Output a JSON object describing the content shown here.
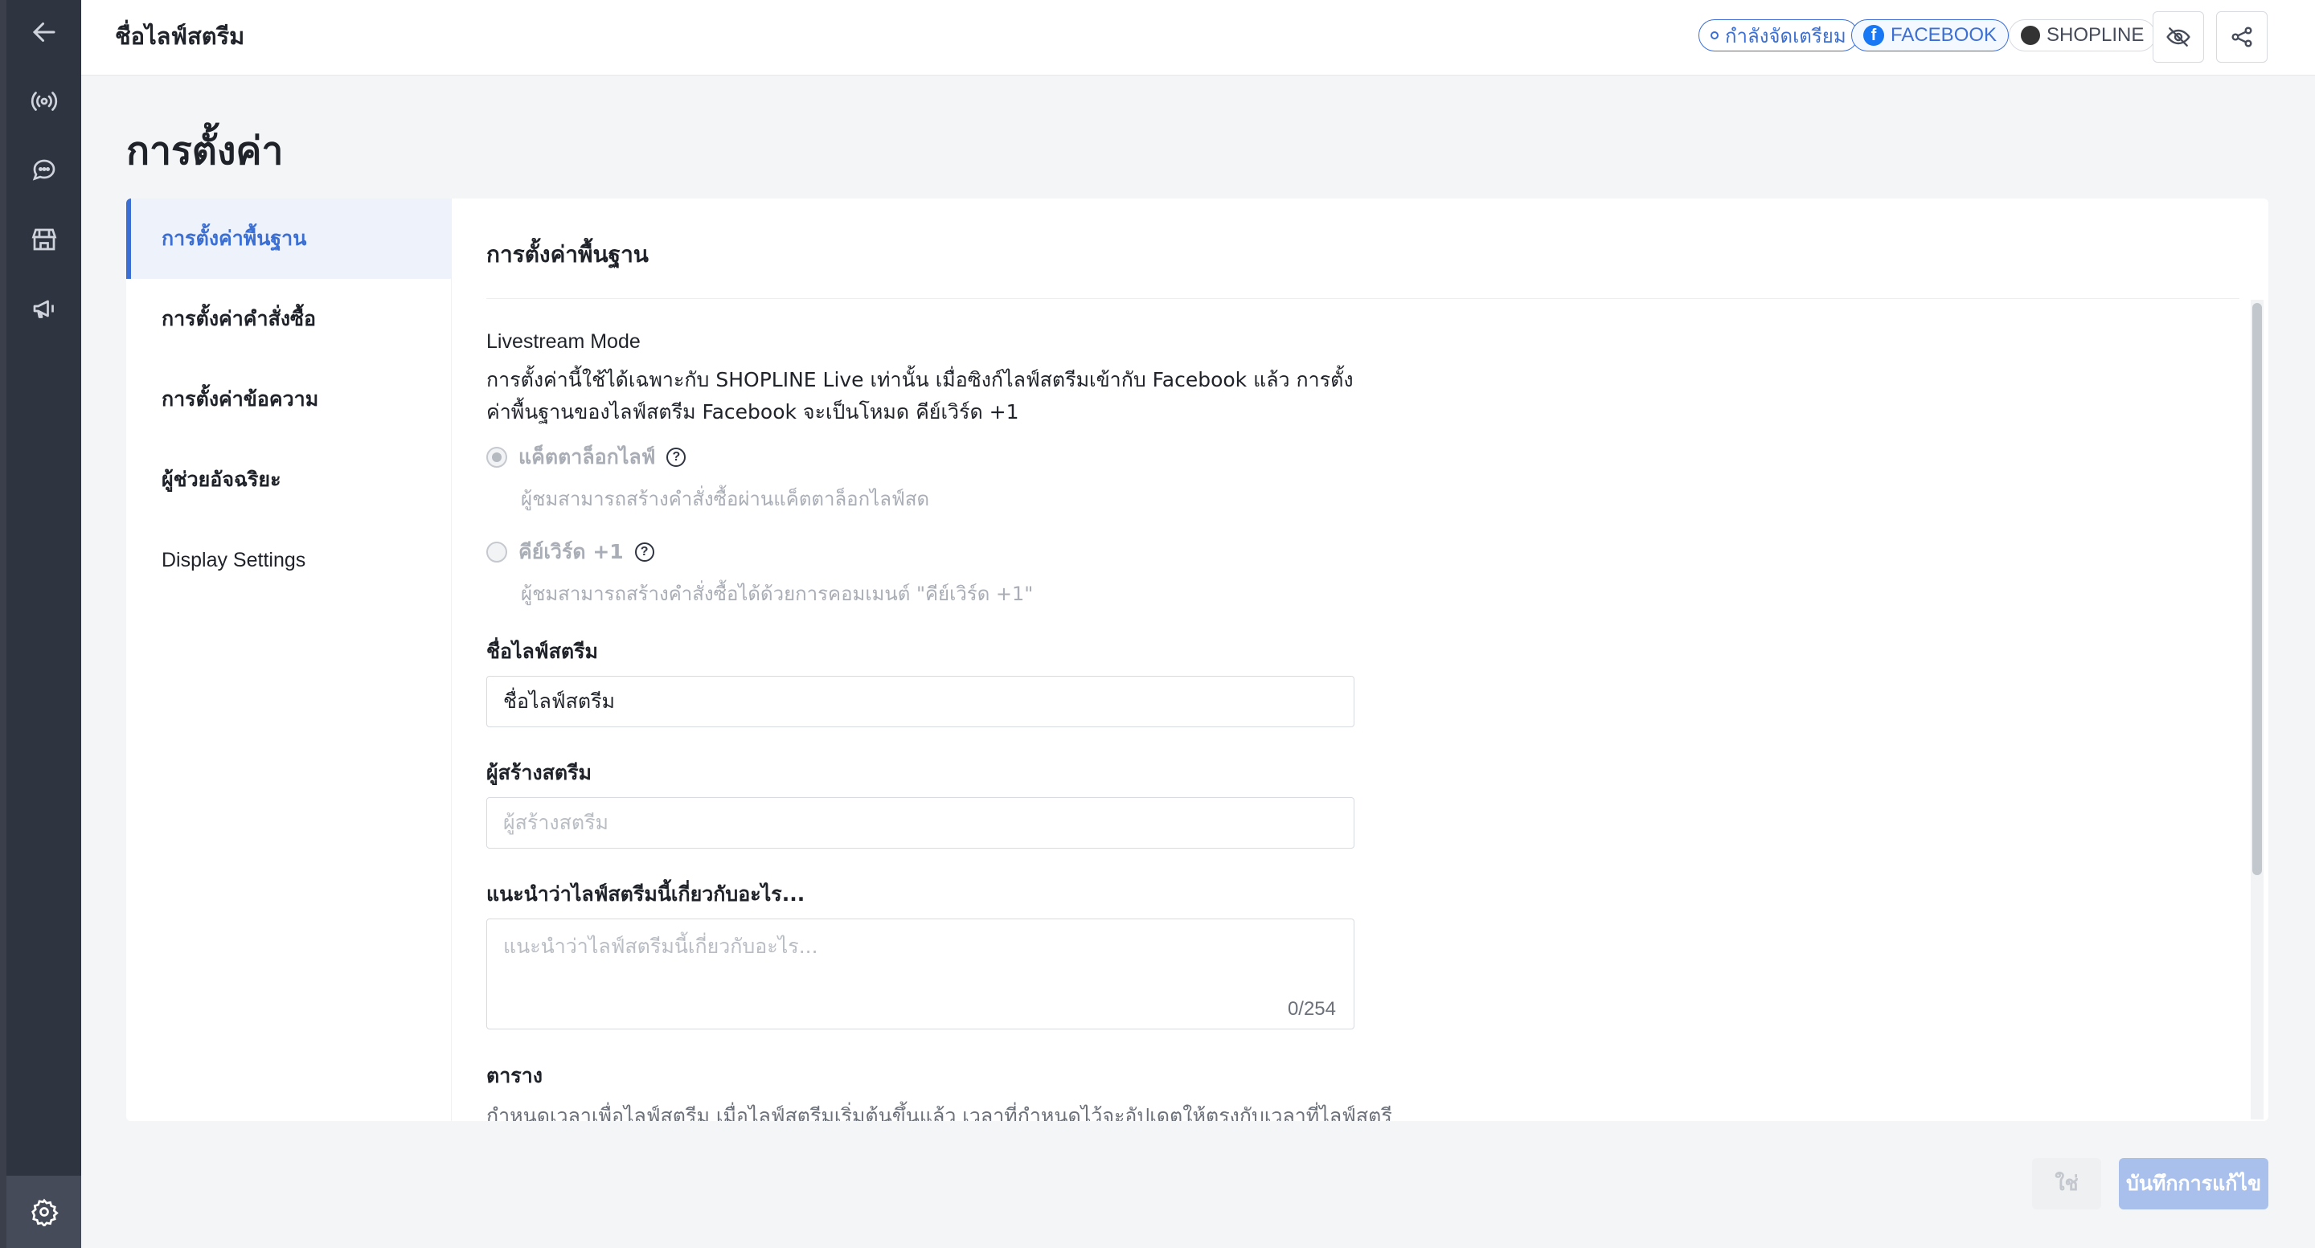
{
  "topbar": {
    "title": "ชื่อไลฟ์สตรีม",
    "status_label": "กำลังจัดเตรียม",
    "facebook_label": "FACEBOOK",
    "shopline_label": "SHOPLINE"
  },
  "page": {
    "title": "การตั้งค่า"
  },
  "subnav": {
    "items": [
      {
        "label": "การตั้งค่าพื้นฐาน"
      },
      {
        "label": "การตั้งค่าคำสั่งซื้อ"
      },
      {
        "label": "การตั้งค่าข้อความ"
      },
      {
        "label": "ผู้ช่วยอัจฉริยะ"
      },
      {
        "label": "Display Settings"
      }
    ]
  },
  "section": {
    "title": "การตั้งค่าพื้นฐาน",
    "mode_label": "Livestream Mode",
    "mode_desc": "การตั้งค่านี้ใช้ได้เฉพาะกับ SHOPLINE Live เท่านั้น เมื่อซิงก์ไลฟ์สตรีมเข้ากับ Facebook แล้ว การตั้งค่าพื้นฐานของไลฟ์สตรีม Facebook จะเป็นโหมด คีย์เวิร์ด +1",
    "option1_label": "แค็ตตาล็อกไลฟ์",
    "option1_desc": "ผู้ชมสามารถสร้างคำสั่งซื้อผ่านแค็ตตาล็อกไลฟ์สด",
    "option2_label": "คีย์เวิร์ด +1",
    "option2_desc": "ผู้ชมสามารถสร้างคำสั่งซื้อได้ด้วยการคอมเมนต์ \"คีย์เวิร์ด +1\"",
    "name_label": "ชื่อไลฟ์สตรีม",
    "name_value": "ชื่อไลฟ์สตรีม",
    "creator_label": "ผู้สร้างสตรีม",
    "creator_placeholder": "ผู้สร้างสตรีม",
    "intro_label": "แนะนำว่าไลฟ์สตรีมนี้เกี่ยวกับอะไร...",
    "intro_placeholder": "แนะนำว่าไลฟ์สตรีมนี้เกี่ยวกับอะไร...",
    "intro_counter": "0/254",
    "schedule_label": "ตาราง",
    "schedule_desc": "กำหนดเวลาเพื่อไลฟ์สตรีม เมื่อไลฟ์สตรีมเริ่มต้นขึ้นแล้ว เวลาที่กำหนดไว้จะอัปเดตให้ตรงกับเวลาที่ไลฟ์สตรี"
  },
  "footer": {
    "cancel_label": "ใช่",
    "save_label": "บันทึกการแก้ไข"
  },
  "colors": {
    "accent": "#3b6fd4",
    "rail": "#2f3441",
    "save_disabled": "#a9c0ec"
  },
  "icons": {
    "rail": [
      "back-arrow-icon",
      "broadcast-icon",
      "chat-icon",
      "store-icon",
      "megaphone-icon",
      "gear-icon"
    ],
    "topbar": [
      "eye-off-icon",
      "share-icon"
    ]
  }
}
